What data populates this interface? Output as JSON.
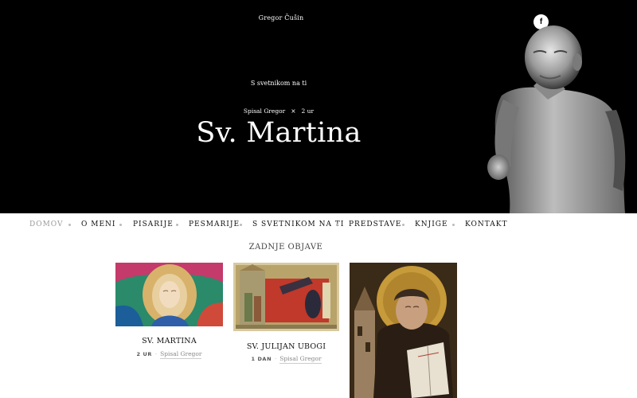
{
  "site": {
    "title": "Gregor Čušin"
  },
  "social": {
    "facebook_icon": "f"
  },
  "hero": {
    "category": "S svetnikom na ti",
    "author_label": "Spisal Gregor",
    "separator": "×",
    "time": "2 ur",
    "title": "Sv. Martina"
  },
  "nav": {
    "items": [
      {
        "label": "DOMOV"
      },
      {
        "label": "O MENI"
      },
      {
        "label": "PISARIJE"
      },
      {
        "label": "PESMARIJE"
      },
      {
        "label": "S SVETNIKOM NA TI"
      },
      {
        "label": "PREDSTAVE"
      },
      {
        "label": "KNJIGE"
      },
      {
        "label": "KONTAKT"
      }
    ]
  },
  "recent": {
    "title": "ZADNJE OBJAVE",
    "posts": [
      {
        "title": "SV. MARTINA",
        "age": "2 UR",
        "sep": "·",
        "author": "Spisal Gregor"
      },
      {
        "title": "SV. JULIJAN UBOGI",
        "age": "1 DAN",
        "sep": "·",
        "author": "Spisal Gregor"
      },
      {
        "title": "",
        "age": "",
        "sep": "",
        "author": ""
      }
    ]
  },
  "colors": {
    "hero_bg": "#000000",
    "nav_active": "#9a9a9a",
    "text": "#111111"
  }
}
